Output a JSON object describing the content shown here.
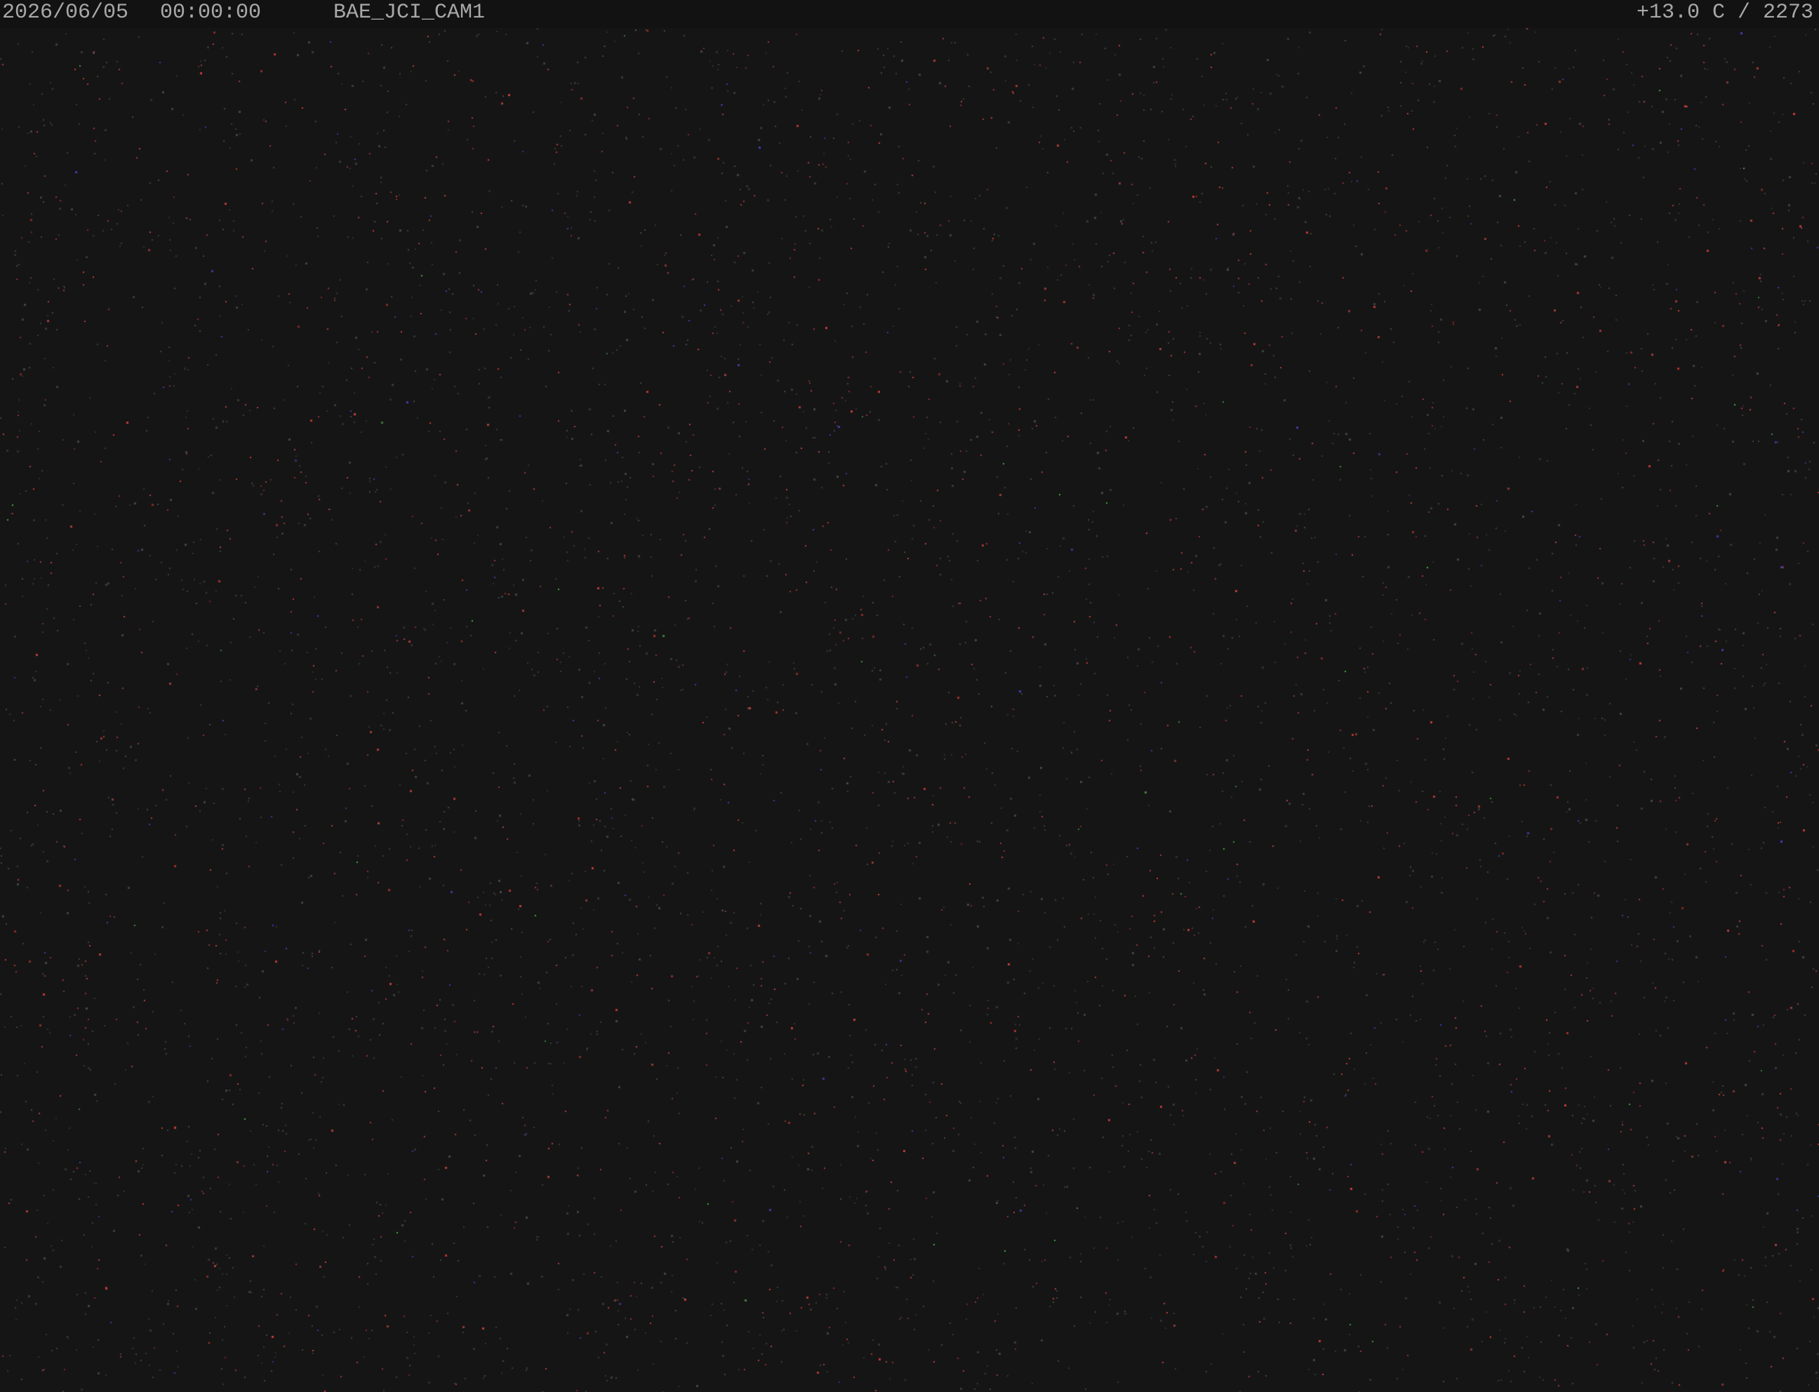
{
  "osd": {
    "date": "2026/06/05",
    "time": "00:00:00",
    "camera_name": "BAE_JCI_CAM1",
    "sensor_readout": "+13.0 C / 2273"
  },
  "colors": {
    "background": "#151515",
    "osd_text": "#a8a8a8",
    "noise_red": "#d23a3a",
    "noise_blue": "#3c3cc8",
    "noise_green": "#46b446",
    "noise_gray": "#4a4a4a"
  }
}
